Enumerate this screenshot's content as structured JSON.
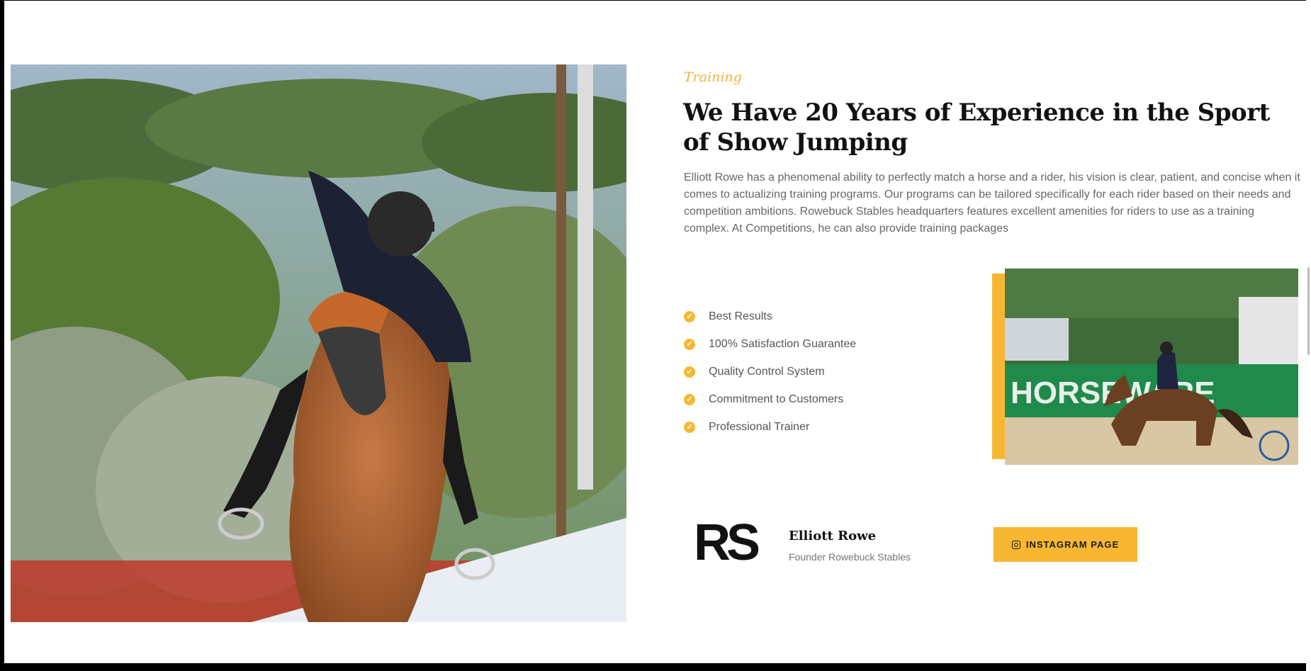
{
  "section": {
    "eyebrow": "Training",
    "headline": "We Have 20 Years of Experience in the Sport of Show Jumping",
    "paragraph": "Elliott Rowe has a phenomenal ability to perfectly match a horse and a rider, his vision is clear, patient, and concise when it comes to actualizing training programs. Our programs can be tailored specifically for each rider based on their needs and competition ambitions. Rowebuck Stables headquarters features excellent amenities for riders to use as a training complex. At Competitions, he can also provide training packages"
  },
  "features": [
    "Best Results",
    "100% Satisfaction Guarantee",
    "Quality Control System",
    "Commitment to Customers",
    "Professional Trainer"
  ],
  "founder": {
    "logo_text": "RS",
    "name": "Elliott Rowe",
    "role": "Founder Rowebuck Stables"
  },
  "cta": {
    "label": "INSTAGRAM PAGE",
    "icon": "instagram-icon"
  },
  "arena_banner_text": "HORSEWARE",
  "colors": {
    "accent": "#f7b733",
    "heading": "#111111",
    "body": "#666666"
  }
}
